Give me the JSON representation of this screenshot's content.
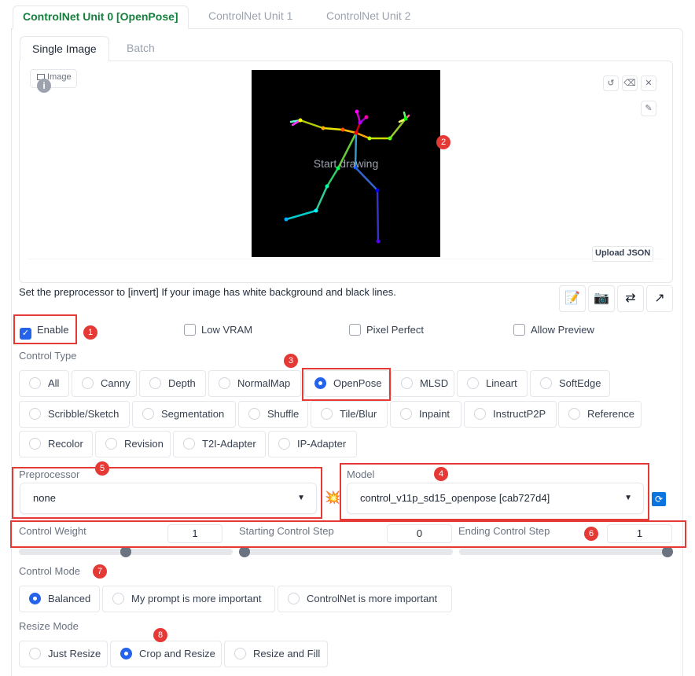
{
  "unit_tabs": [
    "ControlNet Unit 0 [OpenPose]",
    "ControlNet Unit 1",
    "ControlNet Unit 2"
  ],
  "image_tabs": [
    "Single Image",
    "Batch"
  ],
  "image_panel": {
    "label": "Image",
    "canvas_text": "Start drawing",
    "upload_json": "Upload JSON"
  },
  "hint": "Set the preprocessor to [invert] If your image has white background and black lines.",
  "checkboxes": [
    {
      "label": "Enable",
      "checked": true
    },
    {
      "label": "Low VRAM",
      "checked": false
    },
    {
      "label": "Pixel Perfect",
      "checked": false
    },
    {
      "label": "Allow Preview",
      "checked": false
    }
  ],
  "control_type": {
    "label": "Control Type",
    "options": [
      "All",
      "Canny",
      "Depth",
      "NormalMap",
      "OpenPose",
      "MLSD",
      "Lineart",
      "SoftEdge",
      "Scribble/Sketch",
      "Segmentation",
      "Shuffle",
      "Tile/Blur",
      "Inpaint",
      "InstructP2P",
      "Reference",
      "Recolor",
      "Revision",
      "T2I-Adapter",
      "IP-Adapter"
    ],
    "selected": "OpenPose"
  },
  "preprocessor": {
    "label": "Preprocessor",
    "value": "none"
  },
  "model": {
    "label": "Model",
    "value": "control_v11p_sd15_openpose [cab727d4]"
  },
  "sliders": [
    {
      "label": "Control Weight",
      "value": "1",
      "fraction": 0.5
    },
    {
      "label": "Starting Control Step",
      "value": "0",
      "fraction": 0.0
    },
    {
      "label": "Ending Control Step",
      "value": "1",
      "fraction": 1.0
    }
  ],
  "control_mode": {
    "label": "Control Mode",
    "options": [
      "Balanced",
      "My prompt is more important",
      "ControlNet is more important"
    ],
    "selected": "Balanced"
  },
  "resize_mode": {
    "label": "Resize Mode",
    "options": [
      "Just Resize",
      "Crop and Resize",
      "Resize and Fill"
    ],
    "selected": "Crop and Resize"
  },
  "markers": [
    "1",
    "2",
    "3",
    "4",
    "5",
    "6",
    "7",
    "8"
  ],
  "colors": {
    "accent_blue": "#2563eb",
    "active_tab_green": "#15803d",
    "annotation_red": "#e53935"
  }
}
